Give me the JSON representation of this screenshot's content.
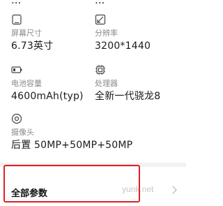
{
  "top_partial": {
    "left": "...",
    "right": "..."
  },
  "specs": [
    {
      "icon": "screen-size-icon",
      "label": "屏幕尺寸",
      "value": "6.73英寸"
    },
    {
      "icon": "resolution-icon",
      "label": "分辨率",
      "value": "3200*1440"
    },
    {
      "icon": "battery-icon",
      "label": "电池容量",
      "value": "4600mAh(typ)"
    },
    {
      "icon": "processor-icon",
      "label": "处理器",
      "value": "全新一代骁龙8"
    },
    {
      "icon": "camera-icon",
      "label": "摄像头",
      "value": "后置 50MP+50MP+50MP"
    }
  ],
  "all_params": {
    "label": "全部参数",
    "chevron": "chevron-right-icon"
  },
  "watermark": "yunk.net",
  "colors": {
    "highlight": "#e02020",
    "label": "#8a8a8a",
    "value": "#1a1a1a"
  }
}
